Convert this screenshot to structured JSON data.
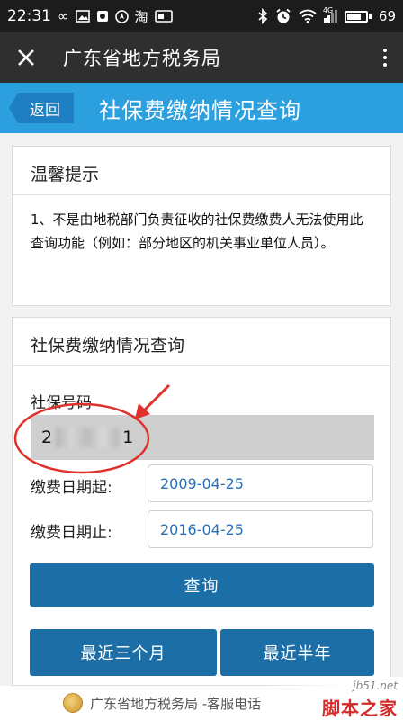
{
  "status_bar": {
    "time": "22:31",
    "left_glyphs": [
      "∞",
      "淘"
    ],
    "network_label": "4G",
    "battery": "69",
    "battery_level": 0.69
  },
  "app_header": {
    "title": "广东省地方税务局"
  },
  "page_bar": {
    "back_label": "返回",
    "title": "社保费缴纳情况查询"
  },
  "tip_panel": {
    "title": "温馨提示",
    "text": "1、不是由地税部门负责征收的社保费缴费人无法使用此查询功能（例如：部分地区的机关事业单位人员）。"
  },
  "query_panel": {
    "title": "社保费缴纳情况查询",
    "ssn_label": "社保号码",
    "ssn_first": "2",
    "ssn_last": "1",
    "start_label": "缴费日期起:",
    "start_value": "2009-04-25",
    "end_label": "缴费日期止:",
    "end_value": "2016-04-25",
    "query_button": "查询",
    "recent_3m_button": "最近三个月",
    "recent_6m_button": "最近半年"
  },
  "footer": {
    "text": "广东省地方税务局 -客服电话"
  },
  "watermark": {
    "site": "jb51.net",
    "name": "脚本之家"
  },
  "colors": {
    "accent_blue": "#2c9fde",
    "button_blue": "#1c6ea6",
    "annotation_red": "#e0302a"
  }
}
